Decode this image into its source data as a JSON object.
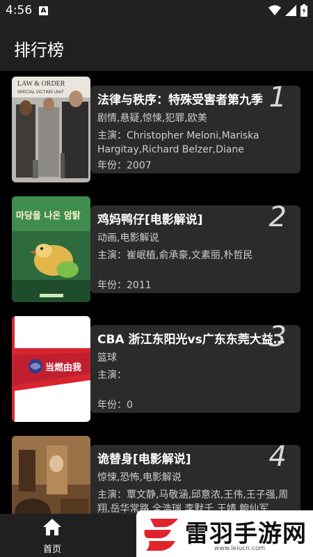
{
  "status": {
    "time": "4:56",
    "badge": "A"
  },
  "app": {
    "title": "排行榜"
  },
  "items": [
    {
      "rank": "1",
      "title": "法律与秩序：特殊受害者第九季",
      "genre": "剧情,悬疑,惊悚,犯罪,欧美",
      "cast": "主演：Christopher Meloni,Mariska Hargitay,Richard Belzer,Diane Neal,Adam ...",
      "year": "年份：2007",
      "poster_text": "LAW & ORDER",
      "poster_sub": "SPECIAL VICTIMS UNIT"
    },
    {
      "rank": "2",
      "title": "鸡妈鸭仔[电影解说]",
      "genre": "动画,电影解说",
      "cast": "主演：崔岷植,俞承豪,文素丽,朴哲民",
      "year": "年份：2011",
      "poster_text": "마당을 나온 암탉"
    },
    {
      "rank": "3",
      "title": "CBA 浙江东阳光vs广东东莞大益…",
      "genre": "篮球",
      "cast": "主演：",
      "year": "年份：0",
      "poster_text": "当燃由我"
    },
    {
      "rank": "4",
      "title": "诡替身[电影解说]",
      "genre": "惊悚,恐怖,电影解说",
      "cast": "主演：覃文静,马敬涵,邱意浓,王伟,王子强,周翔,岳华常路,全浩瑞,李默千,王婧,鲍仙军",
      "year": ""
    }
  ],
  "nav": {
    "home_label": "首页"
  },
  "watermark": {
    "name": "雷羽手游网",
    "url": "www.leiucn.com"
  },
  "colors": {
    "background": "#000000",
    "card": "#2b2b2b",
    "bar": "#202020",
    "watermark_red": "#e0242c"
  }
}
